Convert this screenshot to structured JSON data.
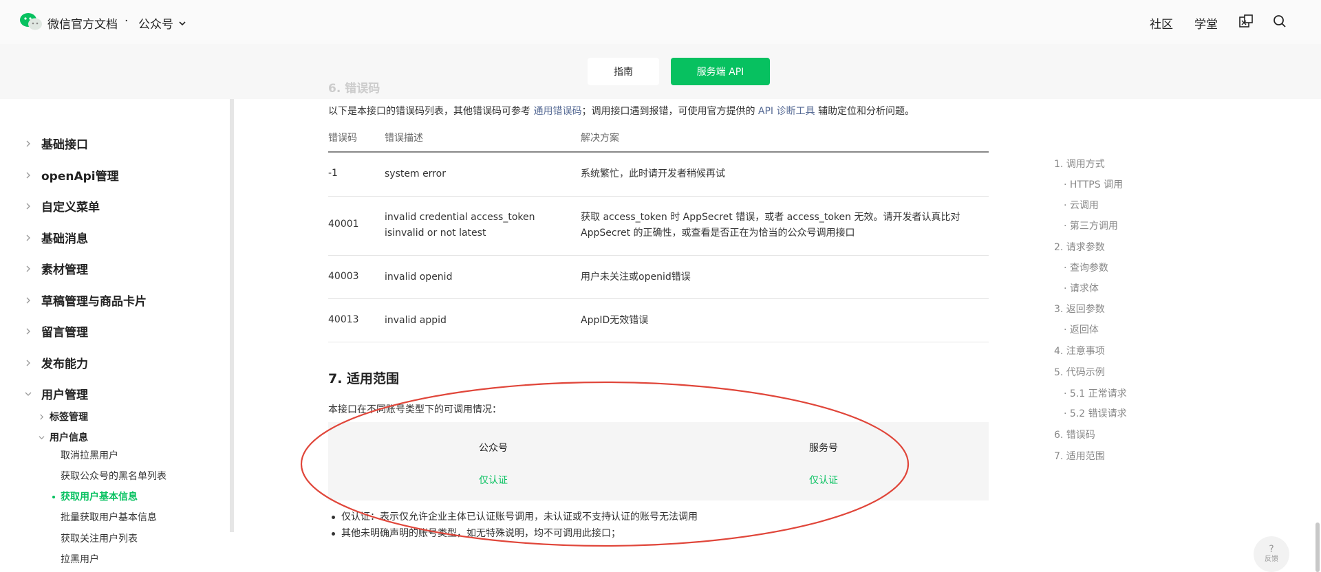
{
  "header": {
    "brand": "微信官方文档",
    "separator": "·",
    "product": "公众号",
    "nav": {
      "community": "社区",
      "academy": "学堂"
    }
  },
  "tabs": {
    "guide": "指南",
    "server_api": "服务端 API"
  },
  "sidebar": {
    "items": [
      {
        "label": "基础接口"
      },
      {
        "label": "openApi管理"
      },
      {
        "label": "自定义菜单"
      },
      {
        "label": "基础消息"
      },
      {
        "label": "素材管理"
      },
      {
        "label": "草稿管理与商品卡片"
      },
      {
        "label": "留言管理"
      },
      {
        "label": "发布能力"
      },
      {
        "label": "用户管理"
      }
    ],
    "sub_items": [
      {
        "label": "标签管理"
      },
      {
        "label": "用户信息"
      }
    ],
    "leaves": [
      {
        "label": "取消拉黑用户"
      },
      {
        "label": "获取公众号的黑名单列表"
      },
      {
        "label": "获取用户基本信息"
      },
      {
        "label": "批量获取用户基本信息"
      },
      {
        "label": "获取关注用户列表"
      },
      {
        "label": "拉黑用户"
      }
    ]
  },
  "content": {
    "faded_section": "6. 错误码",
    "intro": {
      "part1": "以下是本接口的错误码列表，其他错误码可参考 ",
      "link1": "通用错误码",
      "part2": "；调用接口遇到报错，可使用官方提供的 ",
      "link2": "API 诊断工具",
      "part3": " 辅助定位和分析问题。"
    },
    "error_table": {
      "headers": [
        "错误码",
        "错误描述",
        "解决方案"
      ],
      "rows": [
        {
          "code": "-1",
          "desc": "system error",
          "solution": "系统繁忙，此时请开发者稍候再试"
        },
        {
          "code": "40001",
          "desc": "invalid credential  access_token isinvalid or not latest",
          "solution": "获取 access_token 时 AppSecret 错误，或者 access_token 无效。请开发者认真比对 AppSecret 的正确性，或查看是否正在为恰当的公众号调用接口"
        },
        {
          "code": "40003",
          "desc": "invalid openid",
          "solution": "用户未关注或openid错误"
        },
        {
          "code": "40013",
          "desc": "invalid appid",
          "solution": "AppID无效错误"
        }
      ]
    },
    "scope_title": "7. 适用范围",
    "scope_intro": "本接口在不同账号类型下的可调用情况：",
    "scope_table": {
      "headers": [
        "公众号",
        "服务号"
      ],
      "values": [
        "仅认证",
        "仅认证"
      ]
    },
    "notes": [
      "仅认证：表示仅允许企业主体已认证账号调用，未认证或不支持认证的账号无法调用",
      "其他未明确声明的账号类型，如无特殊说明，均不可调用此接口；"
    ]
  },
  "toc": [
    {
      "label": "1. 调用方式",
      "sub": false
    },
    {
      "label": "· HTTPS 调用",
      "sub": true
    },
    {
      "label": "· 云调用",
      "sub": true
    },
    {
      "label": "· 第三方调用",
      "sub": true
    },
    {
      "label": "2. 请求参数",
      "sub": false
    },
    {
      "label": "· 查询参数",
      "sub": true
    },
    {
      "label": "· 请求体",
      "sub": true
    },
    {
      "label": "3. 返回参数",
      "sub": false
    },
    {
      "label": "· 返回体",
      "sub": true
    },
    {
      "label": "4. 注意事项",
      "sub": false
    },
    {
      "label": "5. 代码示例",
      "sub": false
    },
    {
      "label": "· 5.1 正常请求",
      "sub": true
    },
    {
      "label": "· 5.2 错误请求",
      "sub": true
    },
    {
      "label": "6. 错误码",
      "sub": false
    },
    {
      "label": "7. 适用范围",
      "sub": false
    }
  ],
  "feedback": {
    "icon": "?",
    "label": "反馈"
  },
  "colors": {
    "accent": "#07c160",
    "link": "#576b95",
    "annotation": "#e0463a"
  }
}
